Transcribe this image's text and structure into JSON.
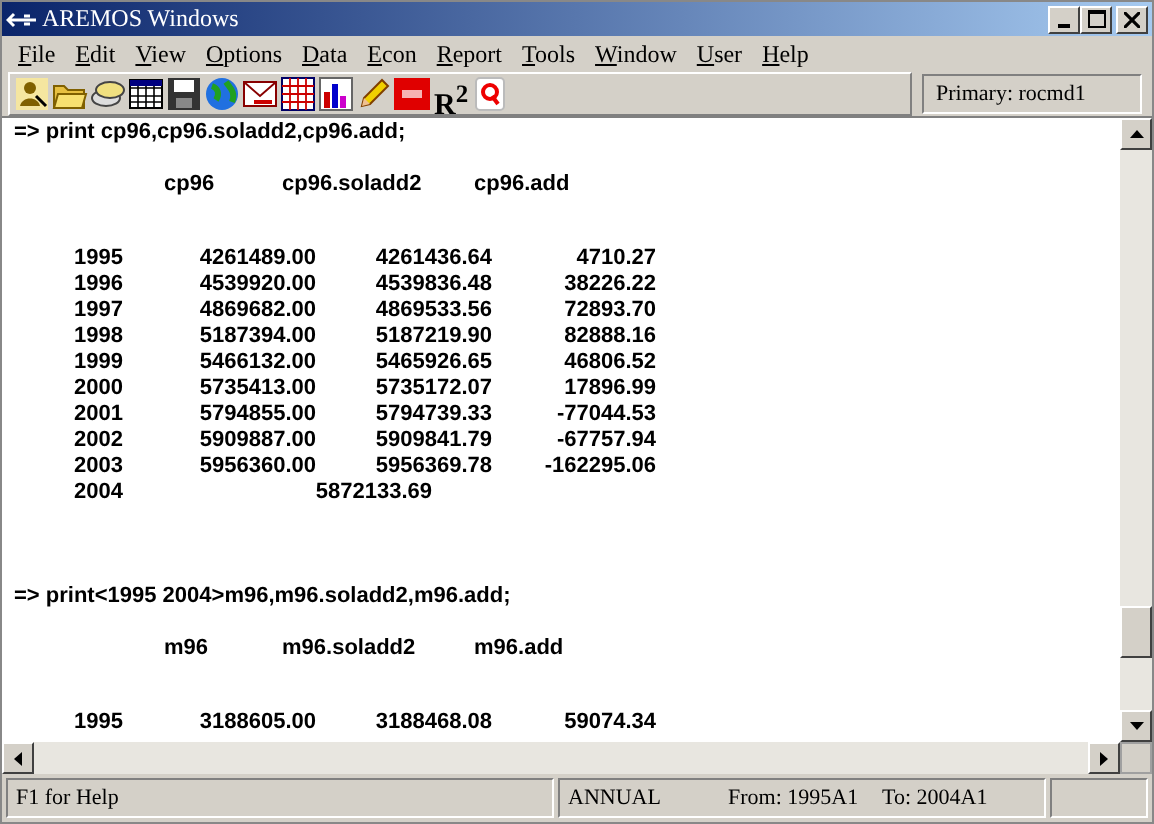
{
  "window": {
    "title": "AREMOS Windows"
  },
  "menu": [
    {
      "label": "File"
    },
    {
      "label": "Edit"
    },
    {
      "label": "View"
    },
    {
      "label": "Options"
    },
    {
      "label": "Data"
    },
    {
      "label": "Econ"
    },
    {
      "label": "Report"
    },
    {
      "label": "Tools"
    },
    {
      "label": "Window"
    },
    {
      "label": "User"
    },
    {
      "label": "Help"
    }
  ],
  "toolbar": {
    "buttons": [
      {
        "kind": "person"
      },
      {
        "kind": "folder"
      },
      {
        "kind": "disks"
      },
      {
        "kind": "grid"
      },
      {
        "kind": "save"
      },
      {
        "kind": "globe"
      },
      {
        "kind": "mail"
      },
      {
        "kind": "table"
      },
      {
        "kind": "chart"
      },
      {
        "kind": "pencil"
      },
      {
        "kind": "red-tag"
      },
      {
        "kind": "text",
        "label": "R$^{2}$"
      },
      {
        "kind": "quit"
      }
    ],
    "primary": "Primary: rocmd1"
  },
  "console": [
    {
      "command": "=> print cp96,cp96.soladd2,cp96.add;",
      "headers": [
        "cp96",
        "cp96.soladd2",
        "cp96.add"
      ],
      "rows": [
        {
          "kind": "full",
          "year": "1995",
          "values": [
            "4261489.00",
            "4261436.64",
            "4710.27"
          ]
        },
        {
          "kind": "full",
          "year": "1996",
          "values": [
            "4539920.00",
            "4539836.48",
            "38226.22"
          ]
        },
        {
          "kind": "full",
          "year": "1997",
          "values": [
            "4869682.00",
            "4869533.56",
            "72893.70"
          ]
        },
        {
          "kind": "full",
          "year": "1998",
          "values": [
            "5187394.00",
            "5187219.90",
            "82888.16"
          ]
        },
        {
          "kind": "full",
          "year": "1999",
          "values": [
            "5466132.00",
            "5465926.65",
            "46806.52"
          ]
        },
        {
          "kind": "full",
          "year": "2000",
          "values": [
            "5735413.00",
            "5735172.07",
            "17896.99"
          ]
        },
        {
          "kind": "full",
          "year": "2001",
          "values": [
            "5794855.00",
            "5794739.33",
            "-77044.53"
          ]
        },
        {
          "kind": "full",
          "year": "2002",
          "values": [
            "5909887.00",
            "5909841.79",
            "-67757.94"
          ]
        },
        {
          "kind": "full",
          "year": "2003",
          "values": [
            "5956360.00",
            "5956369.78",
            "-162295.06"
          ]
        },
        {
          "kind": "merged",
          "year": "2004",
          "values": [
            "5872133.69"
          ]
        }
      ]
    },
    {
      "command": "=> print<1995 2004>m96,m96.soladd2,m96.add;",
      "headers": [
        "m96",
        "m96.soladd2",
        "m96.add"
      ],
      "rows": [
        {
          "kind": "full",
          "year": "1995",
          "values": [
            "3188605.00",
            "3188468.08",
            "59074.34"
          ]
        }
      ]
    }
  ],
  "status_bar": {
    "help": "F1 for Help",
    "frequency": "ANNUAL",
    "from": "From:  1995A1",
    "to": "To:  2004A1"
  }
}
